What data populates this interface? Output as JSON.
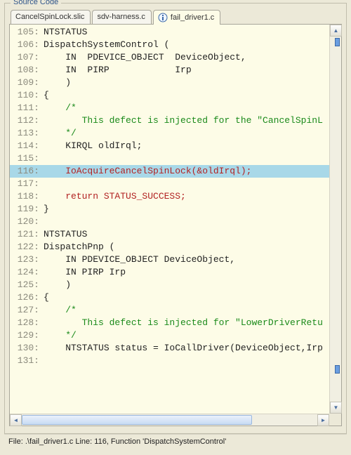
{
  "panel": {
    "title": "Source Code"
  },
  "tabs": [
    {
      "label": "CancelSpinLock.slic",
      "active": false,
      "icon": null
    },
    {
      "label": "sdv-harness.c",
      "active": false,
      "icon": null
    },
    {
      "label": "fail_driver1.c",
      "active": true,
      "icon": "info"
    }
  ],
  "source": {
    "highlight_line": 116,
    "lines": [
      {
        "n": 105,
        "cls": "plain",
        "text": "NTSTATUS"
      },
      {
        "n": 106,
        "cls": "plain",
        "text": "DispatchSystemControl ("
      },
      {
        "n": 107,
        "cls": "plain",
        "text": "    IN  PDEVICE_OBJECT  DeviceObject,"
      },
      {
        "n": 108,
        "cls": "plain",
        "text": "    IN  PIRP            Irp"
      },
      {
        "n": 109,
        "cls": "plain",
        "text": "    )"
      },
      {
        "n": 110,
        "cls": "plain",
        "text": "{"
      },
      {
        "n": 111,
        "cls": "comment",
        "text": "    /*"
      },
      {
        "n": 112,
        "cls": "comment",
        "text": "       This defect is injected for the \"CancelSpinL"
      },
      {
        "n": 113,
        "cls": "comment",
        "text": "    */"
      },
      {
        "n": 114,
        "cls": "plain",
        "text": "    KIRQL oldIrql;"
      },
      {
        "n": 115,
        "cls": "plain",
        "text": ""
      },
      {
        "n": 116,
        "cls": "maroon",
        "text": "    IoAcquireCancelSpinLock(&oldIrql);"
      },
      {
        "n": 117,
        "cls": "plain",
        "text": ""
      },
      {
        "n": 118,
        "cls": "maroon",
        "text": "    return STATUS_SUCCESS;"
      },
      {
        "n": 119,
        "cls": "plain",
        "text": "}"
      },
      {
        "n": 120,
        "cls": "plain",
        "text": ""
      },
      {
        "n": 121,
        "cls": "plain",
        "text": "NTSTATUS"
      },
      {
        "n": 122,
        "cls": "plain",
        "text": "DispatchPnp ("
      },
      {
        "n": 123,
        "cls": "plain",
        "text": "    IN PDEVICE_OBJECT DeviceObject,"
      },
      {
        "n": 124,
        "cls": "plain",
        "text": "    IN PIRP Irp"
      },
      {
        "n": 125,
        "cls": "plain",
        "text": "    )"
      },
      {
        "n": 126,
        "cls": "plain",
        "text": "{"
      },
      {
        "n": 127,
        "cls": "comment",
        "text": "    /*"
      },
      {
        "n": 128,
        "cls": "comment",
        "text": "       This defect is injected for \"LowerDriverRetu"
      },
      {
        "n": 129,
        "cls": "comment",
        "text": "    */"
      },
      {
        "n": 130,
        "cls": "plain",
        "text": "    NTSTATUS status = IoCallDriver(DeviceObject,Irp"
      },
      {
        "n": 131,
        "cls": "plain",
        "text": ""
      }
    ]
  },
  "status": {
    "text": "File: .\\fail_driver1.c  Line: 116,   Function 'DispatchSystemControl'"
  },
  "colors": {
    "bg": "#fdfce7",
    "highlight": "#a8d8e8",
    "comment": "#1a8a1a",
    "error": "#b22222"
  }
}
